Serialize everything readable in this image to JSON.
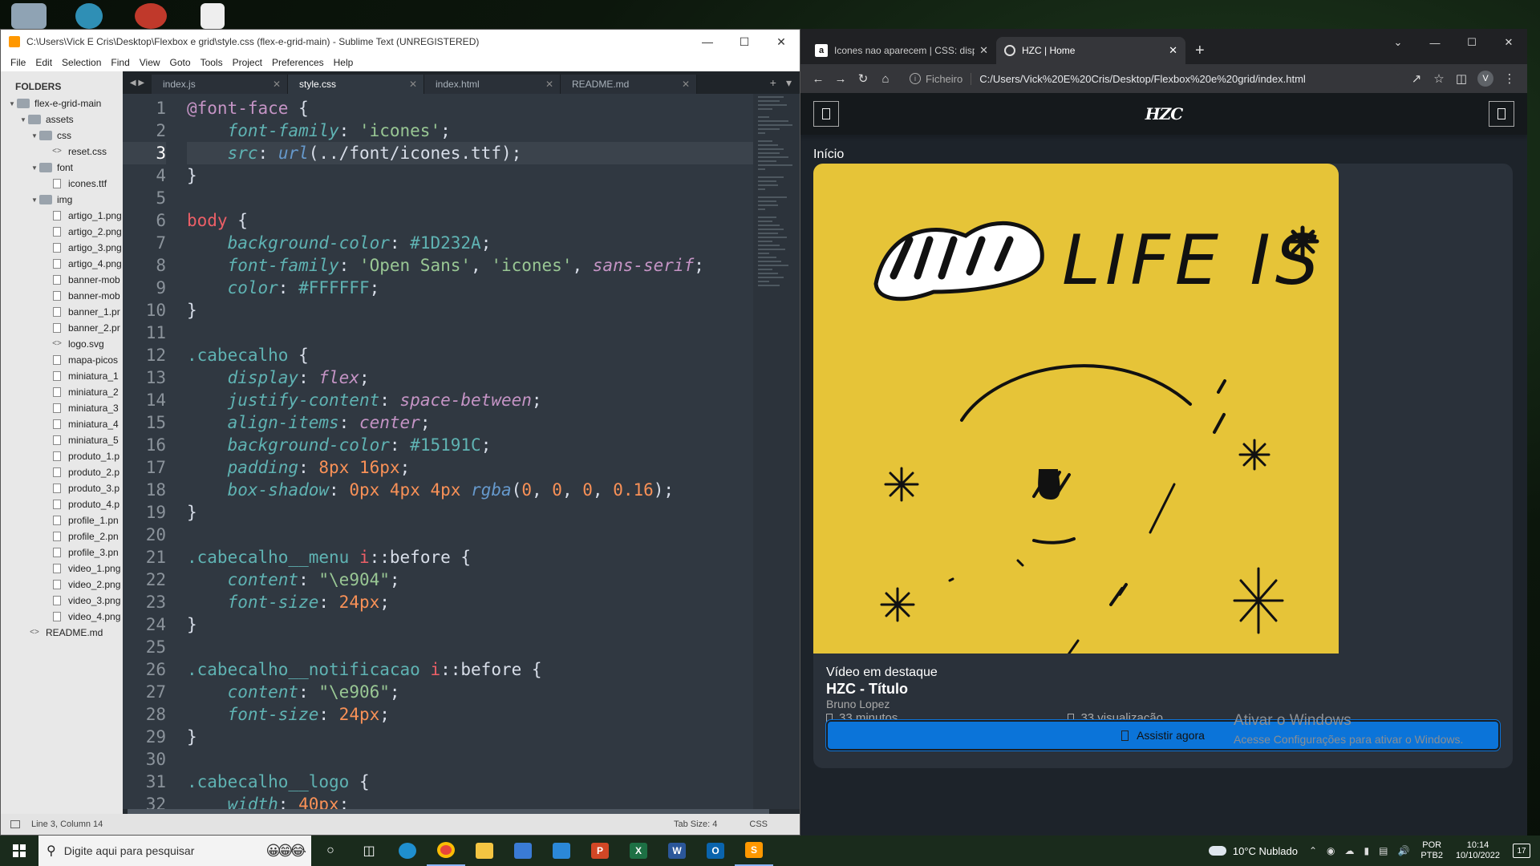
{
  "sublime": {
    "title": "C:\\Users\\Vick E Cris\\Desktop\\Flexbox e grid\\style.css (flex-e-grid-main) - Sublime Text (UNREGISTERED)",
    "menu": [
      "File",
      "Edit",
      "Selection",
      "Find",
      "View",
      "Goto",
      "Tools",
      "Project",
      "Preferences",
      "Help"
    ],
    "sidebar_title": "FOLDERS",
    "tree": [
      {
        "label": "flex-e-grid-main",
        "type": "folder",
        "depth": 0,
        "twisty": "▼"
      },
      {
        "label": "assets",
        "type": "folder",
        "depth": 1,
        "twisty": "▼"
      },
      {
        "label": "css",
        "type": "folder",
        "depth": 2,
        "twisty": "▼"
      },
      {
        "label": "reset.css",
        "type": "code",
        "depth": 3,
        "twisty": ""
      },
      {
        "label": "font",
        "type": "folder",
        "depth": 2,
        "twisty": "▼"
      },
      {
        "label": "icones.ttf",
        "type": "file",
        "depth": 3,
        "twisty": ""
      },
      {
        "label": "img",
        "type": "folder",
        "depth": 2,
        "twisty": "▼"
      },
      {
        "label": "artigo_1.png",
        "type": "file",
        "depth": 3,
        "twisty": ""
      },
      {
        "label": "artigo_2.png",
        "type": "file",
        "depth": 3,
        "twisty": ""
      },
      {
        "label": "artigo_3.png",
        "type": "file",
        "depth": 3,
        "twisty": ""
      },
      {
        "label": "artigo_4.png",
        "type": "file",
        "depth": 3,
        "twisty": ""
      },
      {
        "label": "banner-mob",
        "type": "file",
        "depth": 3,
        "twisty": ""
      },
      {
        "label": "banner-mob",
        "type": "file",
        "depth": 3,
        "twisty": ""
      },
      {
        "label": "banner_1.pr",
        "type": "file",
        "depth": 3,
        "twisty": ""
      },
      {
        "label": "banner_2.pr",
        "type": "file",
        "depth": 3,
        "twisty": ""
      },
      {
        "label": "logo.svg",
        "type": "code",
        "depth": 3,
        "twisty": ""
      },
      {
        "label": "mapa-picos",
        "type": "file",
        "depth": 3,
        "twisty": ""
      },
      {
        "label": "miniatura_1",
        "type": "file",
        "depth": 3,
        "twisty": ""
      },
      {
        "label": "miniatura_2",
        "type": "file",
        "depth": 3,
        "twisty": ""
      },
      {
        "label": "miniatura_3",
        "type": "file",
        "depth": 3,
        "twisty": ""
      },
      {
        "label": "miniatura_4",
        "type": "file",
        "depth": 3,
        "twisty": ""
      },
      {
        "label": "miniatura_5",
        "type": "file",
        "depth": 3,
        "twisty": ""
      },
      {
        "label": "produto_1.p",
        "type": "file",
        "depth": 3,
        "twisty": ""
      },
      {
        "label": "produto_2.p",
        "type": "file",
        "depth": 3,
        "twisty": ""
      },
      {
        "label": "produto_3.p",
        "type": "file",
        "depth": 3,
        "twisty": ""
      },
      {
        "label": "produto_4.p",
        "type": "file",
        "depth": 3,
        "twisty": ""
      },
      {
        "label": "profile_1.pn",
        "type": "file",
        "depth": 3,
        "twisty": ""
      },
      {
        "label": "profile_2.pn",
        "type": "file",
        "depth": 3,
        "twisty": ""
      },
      {
        "label": "profile_3.pn",
        "type": "file",
        "depth": 3,
        "twisty": ""
      },
      {
        "label": "video_1.png",
        "type": "file",
        "depth": 3,
        "twisty": ""
      },
      {
        "label": "video_2.png",
        "type": "file",
        "depth": 3,
        "twisty": ""
      },
      {
        "label": "video_3.png",
        "type": "file",
        "depth": 3,
        "twisty": ""
      },
      {
        "label": "video_4.png",
        "type": "file",
        "depth": 3,
        "twisty": ""
      },
      {
        "label": "README.md",
        "type": "code",
        "depth": 1,
        "twisty": ""
      }
    ],
    "tabs": [
      {
        "label": "index.js",
        "active": false
      },
      {
        "label": "style.css",
        "active": true
      },
      {
        "label": "index.html",
        "active": false
      },
      {
        "label": "README.md",
        "active": false
      }
    ],
    "current_line": 3,
    "code_lines": [
      [
        [
          "k",
          "@font-face"
        ],
        [
          "pun",
          " {"
        ]
      ],
      [
        [
          "pun",
          "    "
        ],
        [
          "p",
          "font-family"
        ],
        [
          "pun",
          ": "
        ],
        [
          "s",
          "'icones'"
        ],
        [
          "pun",
          ";"
        ]
      ],
      [
        [
          "pun",
          "    "
        ],
        [
          "p",
          "src"
        ],
        [
          "pun",
          ": "
        ],
        [
          "fn",
          "url"
        ],
        [
          "pun",
          "(../font/icones.ttf);"
        ]
      ],
      [
        [
          "pun",
          "}"
        ]
      ],
      [],
      [
        [
          "tag",
          "body"
        ],
        [
          "pun",
          " {"
        ]
      ],
      [
        [
          "pun",
          "    "
        ],
        [
          "p",
          "background-color"
        ],
        [
          "pun",
          ": "
        ],
        [
          "sel",
          "#1D232A"
        ],
        [
          "pun",
          ";"
        ]
      ],
      [
        [
          "pun",
          "    "
        ],
        [
          "p",
          "font-family"
        ],
        [
          "pun",
          ": "
        ],
        [
          "s",
          "'Open Sans'"
        ],
        [
          "pun",
          ", "
        ],
        [
          "s",
          "'icones'"
        ],
        [
          "pun",
          ", "
        ],
        [
          "v",
          "sans-serif"
        ],
        [
          "pun",
          ";"
        ]
      ],
      [
        [
          "pun",
          "    "
        ],
        [
          "p",
          "color"
        ],
        [
          "pun",
          ": "
        ],
        [
          "sel",
          "#FFFFFF"
        ],
        [
          "pun",
          ";"
        ]
      ],
      [
        [
          "pun",
          "}"
        ]
      ],
      [],
      [
        [
          "sel",
          ".cabecalho"
        ],
        [
          "pun",
          " {"
        ]
      ],
      [
        [
          "pun",
          "    "
        ],
        [
          "p",
          "display"
        ],
        [
          "pun",
          ": "
        ],
        [
          "v",
          "flex"
        ],
        [
          "pun",
          ";"
        ]
      ],
      [
        [
          "pun",
          "    "
        ],
        [
          "p",
          "justify-content"
        ],
        [
          "pun",
          ": "
        ],
        [
          "v",
          "space-between"
        ],
        [
          "pun",
          ";"
        ]
      ],
      [
        [
          "pun",
          "    "
        ],
        [
          "p",
          "align-items"
        ],
        [
          "pun",
          ": "
        ],
        [
          "v",
          "center"
        ],
        [
          "pun",
          ";"
        ]
      ],
      [
        [
          "pun",
          "    "
        ],
        [
          "p",
          "background-color"
        ],
        [
          "pun",
          ": "
        ],
        [
          "sel",
          "#15191C"
        ],
        [
          "pun",
          ";"
        ]
      ],
      [
        [
          "pun",
          "    "
        ],
        [
          "p",
          "padding"
        ],
        [
          "pun",
          ": "
        ],
        [
          "n",
          "8px"
        ],
        [
          "pun",
          " "
        ],
        [
          "n",
          "16px"
        ],
        [
          "pun",
          ";"
        ]
      ],
      [
        [
          "pun",
          "    "
        ],
        [
          "p",
          "box-shadow"
        ],
        [
          "pun",
          ": "
        ],
        [
          "n",
          "0px"
        ],
        [
          "pun",
          " "
        ],
        [
          "n",
          "4px"
        ],
        [
          "pun",
          " "
        ],
        [
          "n",
          "4px"
        ],
        [
          "pun",
          " "
        ],
        [
          "fn",
          "rgba"
        ],
        [
          "pun",
          "("
        ],
        [
          "n",
          "0"
        ],
        [
          "pun",
          ", "
        ],
        [
          "n",
          "0"
        ],
        [
          "pun",
          ", "
        ],
        [
          "n",
          "0"
        ],
        [
          "pun",
          ", "
        ],
        [
          "n",
          "0.16"
        ],
        [
          "pun",
          ");"
        ]
      ],
      [
        [
          "pun",
          "}"
        ]
      ],
      [],
      [
        [
          "sel",
          ".cabecalho__menu"
        ],
        [
          "pun",
          " "
        ],
        [
          "pse",
          "i"
        ],
        [
          "pun",
          "::before {"
        ]
      ],
      [
        [
          "pun",
          "    "
        ],
        [
          "p",
          "content"
        ],
        [
          "pun",
          ": "
        ],
        [
          "s",
          "\"\\e904\""
        ],
        [
          "pun",
          ";"
        ]
      ],
      [
        [
          "pun",
          "    "
        ],
        [
          "p",
          "font-size"
        ],
        [
          "pun",
          ": "
        ],
        [
          "n",
          "24px"
        ],
        [
          "pun",
          ";"
        ]
      ],
      [
        [
          "pun",
          "}"
        ]
      ],
      [],
      [
        [
          "sel",
          ".cabecalho__notificacao"
        ],
        [
          "pun",
          " "
        ],
        [
          "pse",
          "i"
        ],
        [
          "pun",
          "::before {"
        ]
      ],
      [
        [
          "pun",
          "    "
        ],
        [
          "p",
          "content"
        ],
        [
          "pun",
          ": "
        ],
        [
          "s",
          "\"\\e906\""
        ],
        [
          "pun",
          ";"
        ]
      ],
      [
        [
          "pun",
          "    "
        ],
        [
          "p",
          "font-size"
        ],
        [
          "pun",
          ": "
        ],
        [
          "n",
          "24px"
        ],
        [
          "pun",
          ";"
        ]
      ],
      [
        [
          "pun",
          "}"
        ]
      ],
      [],
      [
        [
          "sel",
          ".cabecalho__logo"
        ],
        [
          "pun",
          " {"
        ]
      ],
      [
        [
          "pun",
          "    "
        ],
        [
          "p",
          "width"
        ],
        [
          "pun",
          ": "
        ],
        [
          "n",
          "40px"
        ],
        [
          "pun",
          ";"
        ]
      ]
    ],
    "status_left": "Line 3, Column 14",
    "status_tab": "Tab Size: 4",
    "status_syntax": "CSS"
  },
  "chrome": {
    "tabs": [
      {
        "label": "Icones nao aparecem | CSS: disp",
        "favicon": "a",
        "active": false
      },
      {
        "label": "HZC | Home",
        "favicon": "",
        "active": true
      }
    ],
    "new_tab": "+",
    "omnibox_label": "Ficheiro",
    "url": "C:/Users/Vick%20E%20Cris/Desktop/Flexbox%20e%20grid/index.html",
    "avatar": "V"
  },
  "site": {
    "logo": "HZC",
    "section_title": "Início",
    "feature_label": "Vídeo em destaque",
    "feature_title": "HZC - Título",
    "feature_author": "Bruno Lopez",
    "duration": "33 minutos",
    "views": "33 visualização",
    "watch_button": "Assistir agora",
    "art_text": "LIFE IS ..."
  },
  "watermark": {
    "line1": "Ativar o Windows",
    "line2": "Acesse Configurações para ativar o Windows."
  },
  "taskbar": {
    "search_placeholder": "Digite aqui para pesquisar",
    "weather": "10°C  Nublado",
    "lang": "POR",
    "layout": "PTB2",
    "time": "10:14",
    "date": "10/10/2022",
    "notifications": "17"
  }
}
